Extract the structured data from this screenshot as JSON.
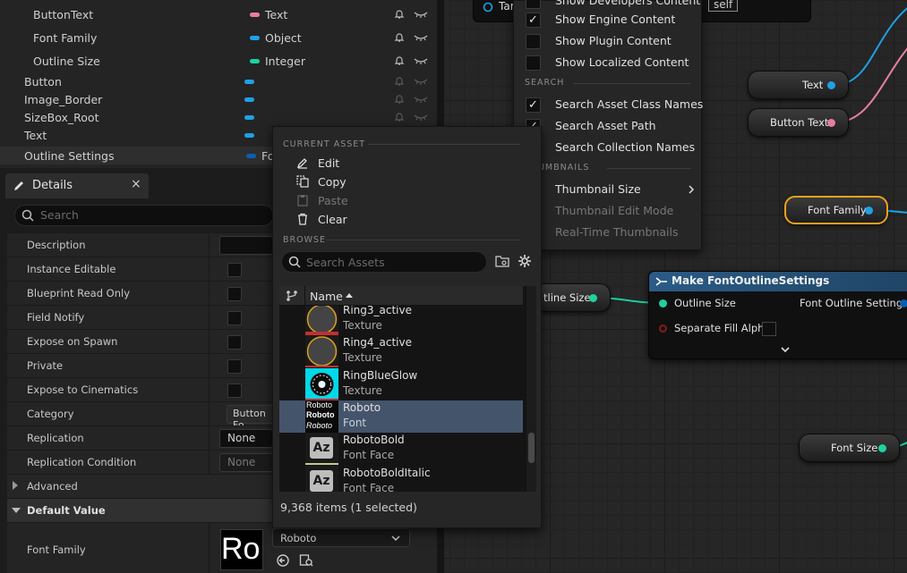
{
  "variables": [
    {
      "name": "ButtonText",
      "type": "Text",
      "color": "#e67ea0"
    },
    {
      "name": "Font Family",
      "type": "Object",
      "color": "#1ea1e6"
    },
    {
      "name": "Outline Size",
      "type": "Integer",
      "color": "#1ed2a0"
    },
    {
      "name": "Button",
      "color": "#1ea1e6"
    },
    {
      "name": "Image_Border",
      "color": "#1ea1e6"
    },
    {
      "name": "SizeBox_Root",
      "color": "#1ea1e6"
    },
    {
      "name": "Text",
      "color": "#1ea1e6"
    },
    {
      "name": "Outline Settings",
      "type": "Fo",
      "color": "#0a5fb4"
    }
  ],
  "details": {
    "tab_title": "Details",
    "close_glyph": "×",
    "search_placeholder": "Search",
    "rows": [
      {
        "label": "Description",
        "kind": "text"
      },
      {
        "label": "Instance Editable",
        "kind": "check"
      },
      {
        "label": "Blueprint Read Only",
        "kind": "check"
      },
      {
        "label": "Field Notify",
        "kind": "check"
      },
      {
        "label": "Expose on Spawn",
        "kind": "check"
      },
      {
        "label": "Private",
        "kind": "check"
      },
      {
        "label": "Expose to Cinematics",
        "kind": "check"
      },
      {
        "label": "Category",
        "value": "Button Fo"
      },
      {
        "label": "Replication",
        "value": "None"
      },
      {
        "label": "Replication Condition",
        "value": "None"
      }
    ],
    "advanced_label": "Advanced",
    "default_value_label": "Default Value",
    "font_family_label": "Font Family",
    "font_preview": "Ro",
    "font_value": "Roboto"
  },
  "settings_menu": {
    "top_partial": "Show Developers Content",
    "items_top": [
      {
        "label": "Show Engine Content",
        "checked": true
      },
      {
        "label": "Show Plugin Content",
        "checked": false
      },
      {
        "label": "Show Localized Content",
        "checked": false
      }
    ],
    "search_section": "SEARCH",
    "items_search": [
      {
        "label": "Search Asset Class Names",
        "checked": true
      },
      {
        "label": "Search Asset Path",
        "checked": true
      },
      {
        "label": "Search Collection Names",
        "checked": true
      }
    ],
    "thumbnails_section": "THUMBNAILS",
    "thumbnail_size": "Thumbnail Size",
    "thumbnail_edit_mode": "Thumbnail Edit Mode",
    "realtime_thumbnails": "Real-Time Thumbnails"
  },
  "picker": {
    "current_asset_section": "CURRENT ASSET",
    "actions": [
      {
        "label": "Edit",
        "icon": "pencil-icon",
        "enabled": true
      },
      {
        "label": "Copy",
        "icon": "copy-icon",
        "enabled": true
      },
      {
        "label": "Paste",
        "icon": "paste-icon",
        "enabled": false
      },
      {
        "label": "Clear",
        "icon": "trash-icon",
        "enabled": true
      }
    ],
    "browse_section": "BROWSE",
    "search_placeholder": "Search Assets",
    "column_name": "Name",
    "assets": [
      {
        "name": "Ring3_active",
        "type": "Texture",
        "thumb": "ring-gold"
      },
      {
        "name": "Ring4_active",
        "type": "Texture",
        "thumb": "ring-gold"
      },
      {
        "name": "RingBlueGlow",
        "type": "Texture",
        "thumb": "ring-blue"
      },
      {
        "name": "Roboto",
        "type": "Font",
        "thumb": "font",
        "selected": true
      },
      {
        "name": "RobotoBold",
        "type": "Font Face",
        "thumb": "fontface"
      },
      {
        "name": "RobotoBoldItalic",
        "type": "Font Face",
        "thumb": "fontface"
      }
    ],
    "font_thumb_text": "Roboto",
    "font_face_glyph": "Az",
    "status": "9,368 items (1 selected)"
  },
  "graph": {
    "target_partial": "Tar",
    "self_label": "self",
    "nodes": {
      "text": "Text",
      "button_text": "Button Text",
      "font_family": "Font Family",
      "outline_size": "tline Size",
      "font_size": "Font Size"
    },
    "make_node": {
      "title": "Make FontOutlineSettings",
      "pin_outline_size": "Outline Size",
      "pin_separate_fill_alpha": "Separate Fill Alpha",
      "pin_output": "Font Outline Settings"
    }
  },
  "colors": {
    "accent_blue": "#1ea1e6",
    "text_pink": "#e67ea0",
    "integer_green": "#1ed2a0",
    "selection": "#44546b",
    "node_header": "#2b5b86",
    "selected_node_outline": "#f0a020"
  }
}
